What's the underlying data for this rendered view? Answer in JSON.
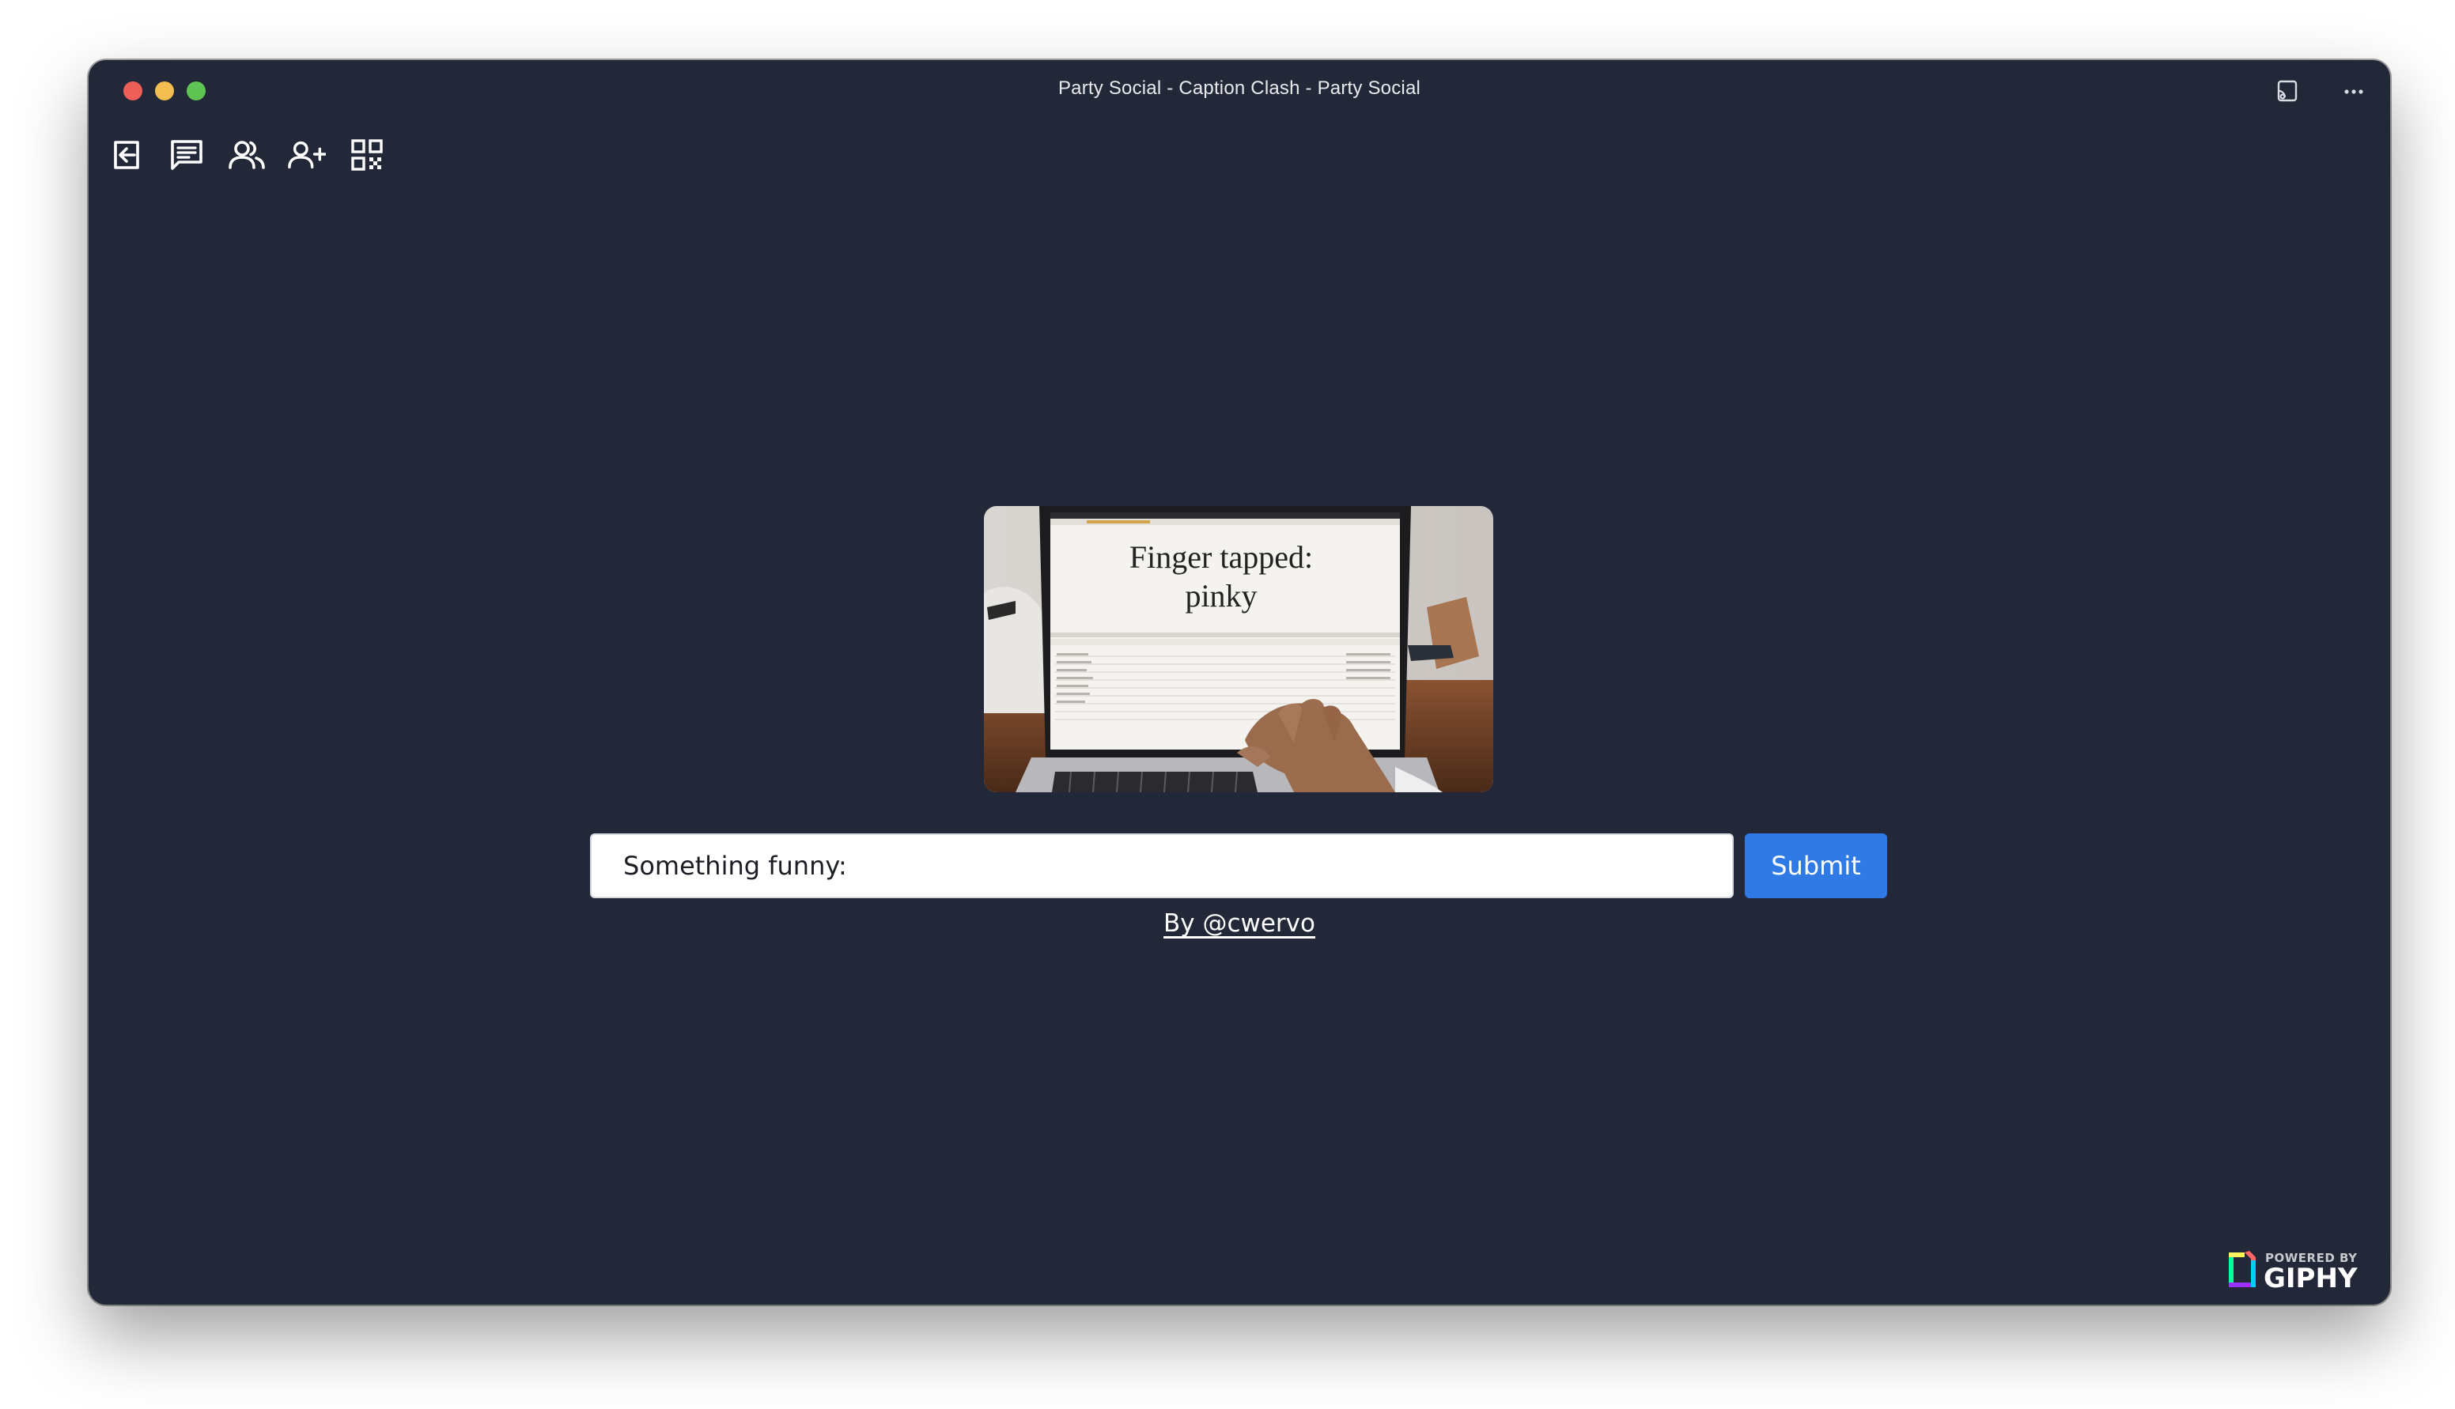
{
  "window": {
    "title": "Party Social - Caption Clash - Party Social"
  },
  "titlebar": {
    "right_icons": [
      "cast-icon",
      "more-icon"
    ]
  },
  "toolbar": {
    "items": [
      {
        "name": "leave-icon"
      },
      {
        "name": "chat-icon"
      },
      {
        "name": "players-icon"
      },
      {
        "name": "invite-icon"
      },
      {
        "name": "qr-code-icon"
      }
    ]
  },
  "gif": {
    "text_line1": "Finger tapped:",
    "text_line2": "pinky"
  },
  "caption": {
    "value": "Something funny:",
    "placeholder": ""
  },
  "submit": {
    "label": "Submit"
  },
  "byline": {
    "text": "By @cwervo"
  },
  "attribution": {
    "powered_by": "POWERED BY",
    "brand": "GIPHY"
  },
  "colors": {
    "background": "#222837",
    "accent": "#2f7ae5"
  }
}
